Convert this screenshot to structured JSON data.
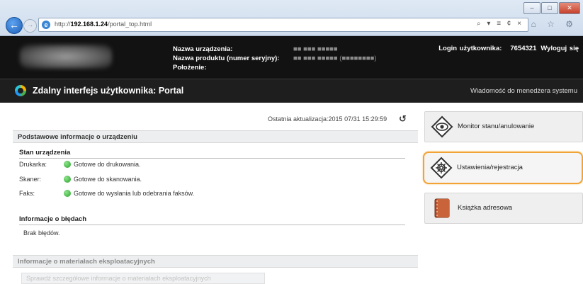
{
  "browser": {
    "url_prefix": "http://",
    "url_host": "192.168.1.24",
    "url_path": "/portal_top.html",
    "address_tools": "⌕ ▾ ≡ ¢ ×",
    "window_buttons": [
      "–",
      "□",
      "✕"
    ],
    "toolbar_icons": "⌂ ☆ ⚙"
  },
  "header": {
    "device_name_label": "Nazwa urządzenia:",
    "product_name_label": "Nazwa produktu (numer seryjny):",
    "location_label": "Położenie:",
    "device_name_value": "■■ ■■■ ■■■■■",
    "product_name_value": "■■ ■■■ ■■■■■ (■■■■■■■■)",
    "location_value": "",
    "login_label": "Login użytkownika:",
    "login_value": "7654321",
    "logout_label": "Wyloguj się"
  },
  "title_bar": {
    "title": "Zdalny interfejs użytkownika: Portal",
    "manager_message": "Wiadomość do menedżera systemu"
  },
  "content": {
    "last_update": "Ostatnia aktualizacja:2015 07/31 15:29:59",
    "basic_info_header": "Podstawowe informacje o urządzeniu",
    "device_status_title": "Stan urządzenia",
    "status_rows": [
      {
        "key": "Drukarka:",
        "text": "Gotowe do drukowania."
      },
      {
        "key": "Skaner:",
        "text": "Gotowe do skanowania."
      },
      {
        "key": "Faks:",
        "text": "Gotowe do wysłania lub odebrania faksów."
      }
    ],
    "error_info_title": "Informacje o błędach",
    "error_info_text": "Brak błędów.",
    "consumables_header": "Informacje o materiałach eksploatacyjnych",
    "consumables_button": "Sprawdź szczegółowe informacje o materiałach eksploatacyjnych"
  },
  "menu": {
    "status_monitor": "Monitor stanu/anulowanie",
    "settings": "Ustawienia/rejestracja",
    "address_book": "Książka adresowa"
  },
  "colors": {
    "header_bg": "#121212",
    "active_border": "#f2a335",
    "status_green": "#28a32a"
  }
}
